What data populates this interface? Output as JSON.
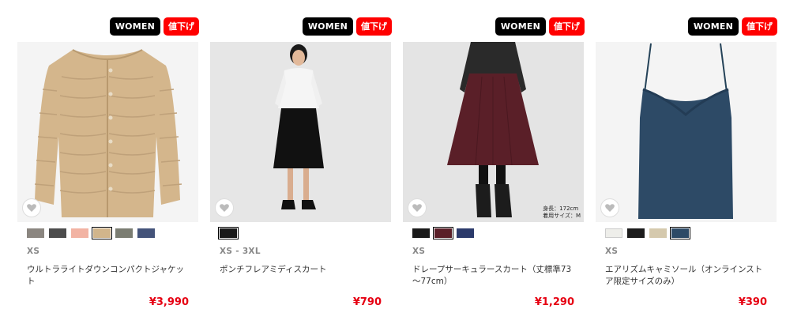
{
  "products": [
    {
      "badge_gender": "WOMEN",
      "badge_sale": "値下げ",
      "swatches": [
        "#8b8680",
        "#4c4c4c",
        "#f2b3a3",
        "#d1b58b",
        "#7b7d72",
        "#44537a"
      ],
      "selected_swatch": 3,
      "sizes": "XS",
      "name": "ウルトラライトダウンコンパクトジャケット",
      "price": "¥3,990"
    },
    {
      "badge_gender": "WOMEN",
      "badge_sale": "値下げ",
      "swatches": [
        "#1a1a1a"
      ],
      "selected_swatch": 0,
      "sizes": "XS - 3XL",
      "name": "ポンチフレアミディスカート",
      "price": "¥790"
    },
    {
      "badge_gender": "WOMEN",
      "badge_sale": "値下げ",
      "model_note": "身長：172cm\n着用サイズ：M",
      "swatches": [
        "#1a1a1a",
        "#5a1f28",
        "#2b3a6b"
      ],
      "selected_swatch": 1,
      "sizes": "XS",
      "name": "ドレープサーキュラースカート（丈標準73～77cm）",
      "price": "¥1,290"
    },
    {
      "badge_gender": "WOMEN",
      "badge_sale": "値下げ",
      "swatches": [
        "#eeeeea",
        "#1c1c1c",
        "#d5c9ad",
        "#2d4a66"
      ],
      "selected_swatch": 3,
      "sizes": "XS",
      "name": "エアリズムキャミソール（オンラインストア限定サイズのみ）",
      "price": "¥390"
    }
  ]
}
